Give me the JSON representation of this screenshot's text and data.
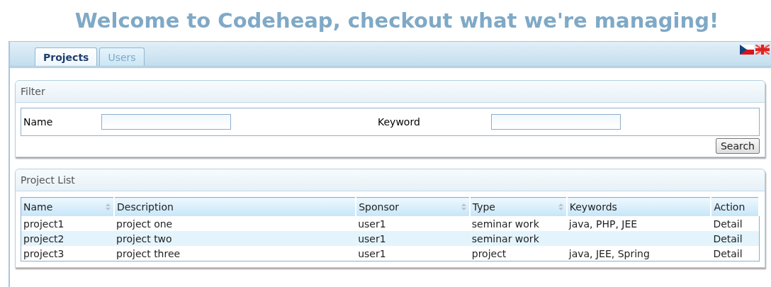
{
  "heading": "Welcome to Codeheap, checkout what we're managing!",
  "tabs": [
    {
      "label": "Projects",
      "selected": true
    },
    {
      "label": "Users",
      "selected": false
    }
  ],
  "filter": {
    "title": "Filter",
    "fields": [
      {
        "label": "Name"
      },
      {
        "label": "Keyword"
      }
    ],
    "button": "Search"
  },
  "project_list": {
    "title": "Project List",
    "columns": [
      {
        "label": "Name",
        "sortable": true
      },
      {
        "label": "Description",
        "sortable": false
      },
      {
        "label": "Sponsor",
        "sortable": true
      },
      {
        "label": "Type",
        "sortable": true
      },
      {
        "label": "Keywords",
        "sortable": false
      },
      {
        "label": "Action",
        "sortable": false
      }
    ],
    "rows": [
      [
        "project1",
        "project one",
        "user1",
        "seminar work",
        "java, PHP, JEE",
        "Detail"
      ],
      [
        "project2",
        "project two",
        "user1",
        "seminar work",
        "",
        "Detail"
      ],
      [
        "project3",
        "project three",
        "user1",
        "project",
        "java, JEE, Spring",
        "Detail"
      ]
    ]
  }
}
